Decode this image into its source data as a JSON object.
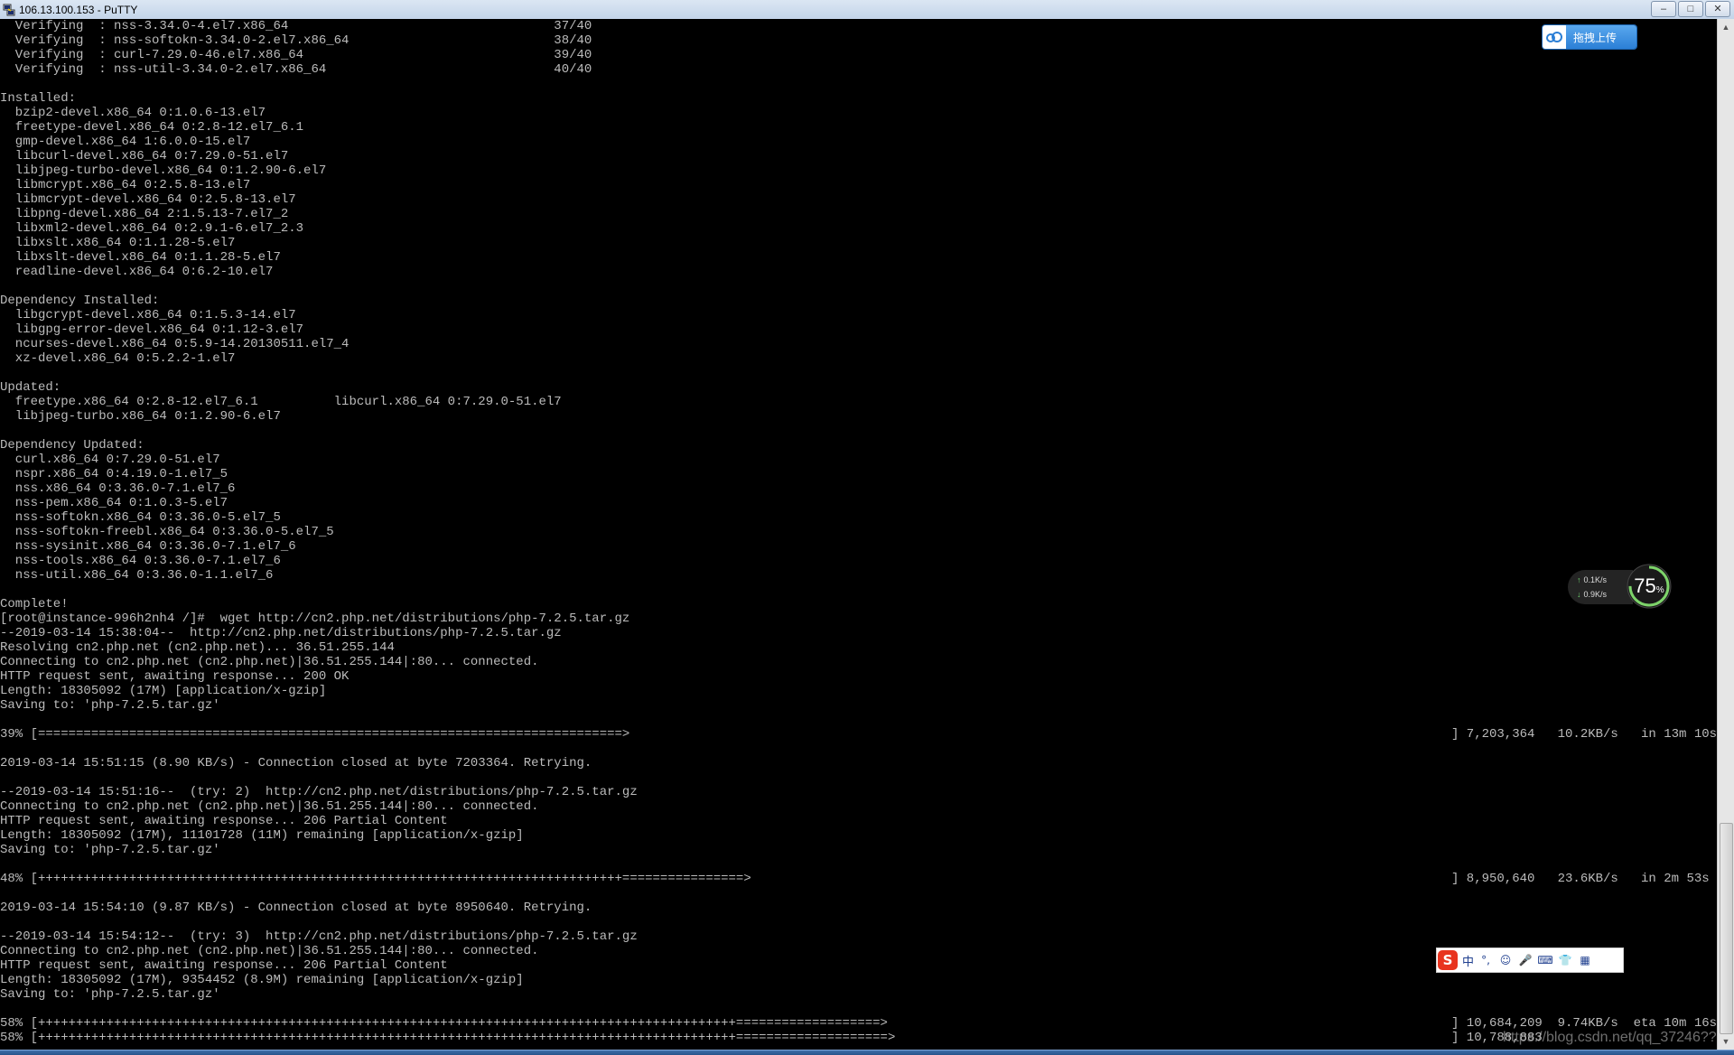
{
  "window": {
    "title": "106.13.100.153 - PuTTY",
    "buttons": {
      "minimize": "–",
      "maximize": "□",
      "close": "✕"
    }
  },
  "terminal": {
    "lines": [
      {
        "text": "  Verifying  : nss-3.34.0-4.el7.x86_64                                   37/40"
      },
      {
        "text": "  Verifying  : nss-softokn-3.34.0-2.el7.x86_64                           38/40"
      },
      {
        "text": "  Verifying  : curl-7.29.0-46.el7.x86_64                                 39/40"
      },
      {
        "text": "  Verifying  : nss-util-3.34.0-2.el7.x86_64                              40/40"
      },
      {
        "text": ""
      },
      {
        "text": "Installed:"
      },
      {
        "text": "  bzip2-devel.x86_64 0:1.0.6-13.el7"
      },
      {
        "text": "  freetype-devel.x86_64 0:2.8-12.el7_6.1"
      },
      {
        "text": "  gmp-devel.x86_64 1:6.0.0-15.el7"
      },
      {
        "text": "  libcurl-devel.x86_64 0:7.29.0-51.el7"
      },
      {
        "text": "  libjpeg-turbo-devel.x86_64 0:1.2.90-6.el7"
      },
      {
        "text": "  libmcrypt.x86_64 0:2.5.8-13.el7"
      },
      {
        "text": "  libmcrypt-devel.x86_64 0:2.5.8-13.el7"
      },
      {
        "text": "  libpng-devel.x86_64 2:1.5.13-7.el7_2"
      },
      {
        "text": "  libxml2-devel.x86_64 0:2.9.1-6.el7_2.3"
      },
      {
        "text": "  libxslt.x86_64 0:1.1.28-5.el7"
      },
      {
        "text": "  libxslt-devel.x86_64 0:1.1.28-5.el7"
      },
      {
        "text": "  readline-devel.x86_64 0:6.2-10.el7"
      },
      {
        "text": ""
      },
      {
        "text": "Dependency Installed:"
      },
      {
        "text": "  libgcrypt-devel.x86_64 0:1.5.3-14.el7"
      },
      {
        "text": "  libgpg-error-devel.x86_64 0:1.12-3.el7"
      },
      {
        "text": "  ncurses-devel.x86_64 0:5.9-14.20130511.el7_4"
      },
      {
        "text": "  xz-devel.x86_64 0:5.2.2-1.el7"
      },
      {
        "text": ""
      },
      {
        "text": "Updated:"
      },
      {
        "text": "  freetype.x86_64 0:2.8-12.el7_6.1          libcurl.x86_64 0:7.29.0-51.el7"
      },
      {
        "text": "  libjpeg-turbo.x86_64 0:1.2.90-6.el7"
      },
      {
        "text": ""
      },
      {
        "text": "Dependency Updated:"
      },
      {
        "text": "  curl.x86_64 0:7.29.0-51.el7"
      },
      {
        "text": "  nspr.x86_64 0:4.19.0-1.el7_5"
      },
      {
        "text": "  nss.x86_64 0:3.36.0-7.1.el7_6"
      },
      {
        "text": "  nss-pem.x86_64 0:1.0.3-5.el7"
      },
      {
        "text": "  nss-softokn.x86_64 0:3.36.0-5.el7_5"
      },
      {
        "text": "  nss-softokn-freebl.x86_64 0:3.36.0-5.el7_5"
      },
      {
        "text": "  nss-sysinit.x86_64 0:3.36.0-7.1.el7_6"
      },
      {
        "text": "  nss-tools.x86_64 0:3.36.0-7.1.el7_6"
      },
      {
        "text": "  nss-util.x86_64 0:3.36.0-1.1.el7_6"
      },
      {
        "text": ""
      },
      {
        "text": "Complete!"
      },
      {
        "text": "[root@instance-996h2nh4 /]#  wget http://cn2.php.net/distributions/php-7.2.5.tar.gz"
      },
      {
        "text": "--2019-03-14 15:38:04--  http://cn2.php.net/distributions/php-7.2.5.tar.gz"
      },
      {
        "text": "Resolving cn2.php.net (cn2.php.net)... 36.51.255.144"
      },
      {
        "text": "Connecting to cn2.php.net (cn2.php.net)|36.51.255.144|:80... connected."
      },
      {
        "text": "HTTP request sent, awaiting response... 200 OK"
      },
      {
        "text": "Length: 18305092 (17M) [application/x-gzip]"
      },
      {
        "text": "Saving to: 'php-7.2.5.tar.gz'"
      },
      {
        "text": ""
      },
      {
        "text": "39% [=============================================================================>",
        "right": "] 7,203,364   10.2KB/s   in 13m 10s"
      },
      {
        "text": ""
      },
      {
        "text": "2019-03-14 15:51:15 (8.90 KB/s) - Connection closed at byte 7203364. Retrying."
      },
      {
        "text": ""
      },
      {
        "text": "--2019-03-14 15:51:16--  (try: 2)  http://cn2.php.net/distributions/php-7.2.5.tar.gz"
      },
      {
        "text": "Connecting to cn2.php.net (cn2.php.net)|36.51.255.144|:80... connected."
      },
      {
        "text": "HTTP request sent, awaiting response... 206 Partial Content"
      },
      {
        "text": "Length: 18305092 (17M), 11101728 (11M) remaining [application/x-gzip]"
      },
      {
        "text": "Saving to: 'php-7.2.5.tar.gz'"
      },
      {
        "text": ""
      },
      {
        "text": "48% [+++++++++++++++++++++++++++++++++++++++++++++++++++++++++++++++++++++++++++++================>",
        "right": "] 8,950,640   23.6KB/s   in 2m 53s"
      },
      {
        "text": ""
      },
      {
        "text": "2019-03-14 15:54:10 (9.87 KB/s) - Connection closed at byte 8950640. Retrying."
      },
      {
        "text": ""
      },
      {
        "text": "--2019-03-14 15:54:12--  (try: 3)  http://cn2.php.net/distributions/php-7.2.5.tar.gz"
      },
      {
        "text": "Connecting to cn2.php.net (cn2.php.net)|36.51.255.144|:80... connected."
      },
      {
        "text": "HTTP request sent, awaiting response... 206 Partial Content"
      },
      {
        "text": "Length: 18305092 (17M), 9354452 (8.9M) remaining [application/x-gzip]"
      },
      {
        "text": "Saving to: 'php-7.2.5.tar.gz'"
      },
      {
        "text": ""
      },
      {
        "text": "58% [++++++++++++++++++++++++++++++++++++++++++++++++++++++++++++++++++++++++++++++++++++++++++++===================>",
        "right": "] 10,684,209  9.74KB/s  eta 10m 16s"
      },
      {
        "text": "58% [++++++++++++++++++++++++++++++++++++++++++++++++++++++++++++++++++++++++++++++++++++++++++++====================>",
        "right": "] 10,788,883"
      }
    ]
  },
  "upload_button": {
    "label": "拖拽上传",
    "icon": "cloud-icon"
  },
  "net_monitor": {
    "upload_rate": "0.1K/s",
    "download_rate": "0.9K/s",
    "percent": "75",
    "percent_unit": "%",
    "percent_value": 75
  },
  "ime_toolbar": {
    "logo": "S",
    "mode": "中",
    "punct": "°,",
    "icons": [
      "☺",
      "🎤",
      "⌨",
      "👕",
      "▦"
    ]
  },
  "watermark": "https://blog.csdn.net/qq_37246??",
  "colors": {
    "terminal_bg": "#000000",
    "terminal_fg": "#bbbbbb",
    "accent_blue": "#2b7fd6"
  }
}
